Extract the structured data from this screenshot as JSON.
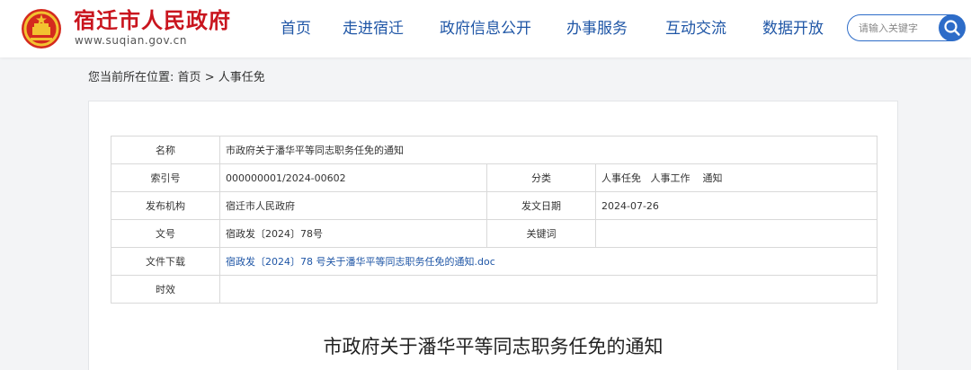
{
  "header": {
    "site_name": "宿迁市人民政府",
    "site_url": "www.suqian.gov.cn",
    "nav": [
      {
        "label": "首页"
      },
      {
        "label": "走进宿迁"
      },
      {
        "label": "政府信息公开"
      },
      {
        "label": "办事服务"
      },
      {
        "label": "互动交流"
      },
      {
        "label": "数据开放"
      }
    ],
    "search_placeholder": "请输入关键字"
  },
  "breadcrumb": {
    "prefix": "您当前所在位置:",
    "home": "首页",
    "separator": ">",
    "current": "人事任免"
  },
  "info_table": {
    "name_label": "名称",
    "name_value": "市政府关于潘华平等同志职务任免的通知",
    "index_label": "索引号",
    "index_value": "000000001/2024-00602",
    "category_label": "分类",
    "category_value": "人事任免   人事工作    通知",
    "publisher_label": "发布机构",
    "publisher_value": "宿迁市人民政府",
    "date_label": "发文日期",
    "date_value": "2024-07-26",
    "docno_label": "文号",
    "docno_value": "宿政发〔2024〕78号",
    "keywords_label": "关键词",
    "keywords_value": "",
    "download_label": "文件下载",
    "download_value": "宿政发〔2024〕78 号关于潘华平等同志职务任免的通知.doc",
    "validity_label": "时效",
    "validity_value": ""
  },
  "article": {
    "title": "市政府关于潘华平等同志职务任免的通知"
  },
  "colors": {
    "brand_red": "#c9151e",
    "nav_blue": "#1f56a6",
    "search_blue": "#2d6cc8"
  }
}
